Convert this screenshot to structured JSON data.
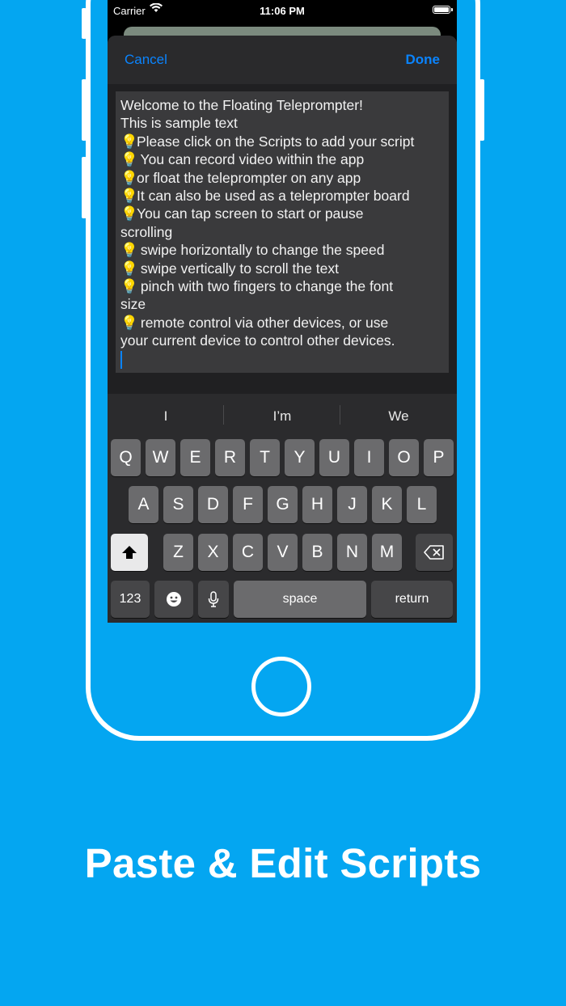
{
  "status_bar": {
    "carrier": "Carrier",
    "time": "11:06 PM"
  },
  "nav": {
    "cancel_label": "Cancel",
    "done_label": "Done"
  },
  "editor": {
    "lines": [
      {
        "bulb": "",
        "text": "Welcome to the Floating Teleprompter!"
      },
      {
        "bulb": "",
        "text": "This is sample text"
      },
      {
        "bulb": "💡",
        "text": "Please click on the Scripts to add your script"
      },
      {
        "bulb": "💡",
        "text": " You can record video within the app"
      },
      {
        "bulb": "💡",
        "text": "or float the teleprompter on any app"
      },
      {
        "bulb": "💡",
        "text": "It can also be used as a teleprompter board"
      },
      {
        "bulb": "💡",
        "text": "You can tap screen to start or pause"
      },
      {
        "bulb": "",
        "text": "scrolling"
      },
      {
        "bulb": "💡",
        "text": " swipe horizontally to change the speed"
      },
      {
        "bulb": "💡",
        "text": " swipe vertically to scroll the text"
      },
      {
        "bulb": "💡",
        "text": " pinch with two fingers to change the font"
      },
      {
        "bulb": "",
        "text": "size"
      },
      {
        "bulb": "💡",
        "text": " remote control via other devices, or use"
      },
      {
        "bulb": "",
        "text": "your current device to control other devices."
      }
    ]
  },
  "keyboard": {
    "suggestions": [
      "I",
      "I’m",
      "We"
    ],
    "row1": [
      "Q",
      "W",
      "E",
      "R",
      "T",
      "Y",
      "U",
      "I",
      "O",
      "P"
    ],
    "row2": [
      "A",
      "S",
      "D",
      "F",
      "G",
      "H",
      "J",
      "K",
      "L"
    ],
    "row3": [
      "Z",
      "X",
      "C",
      "V",
      "B",
      "N",
      "M"
    ],
    "numbers_label": "123",
    "space_label": "space",
    "return_label": "return",
    "icons": {
      "shift": "shift-icon",
      "delete": "delete-icon",
      "emoji": "emoji-icon",
      "mic": "mic-icon"
    }
  },
  "caption": "Paste & Edit Scripts",
  "colors": {
    "background": "#04a6f1",
    "accent": "#0a84ff"
  }
}
